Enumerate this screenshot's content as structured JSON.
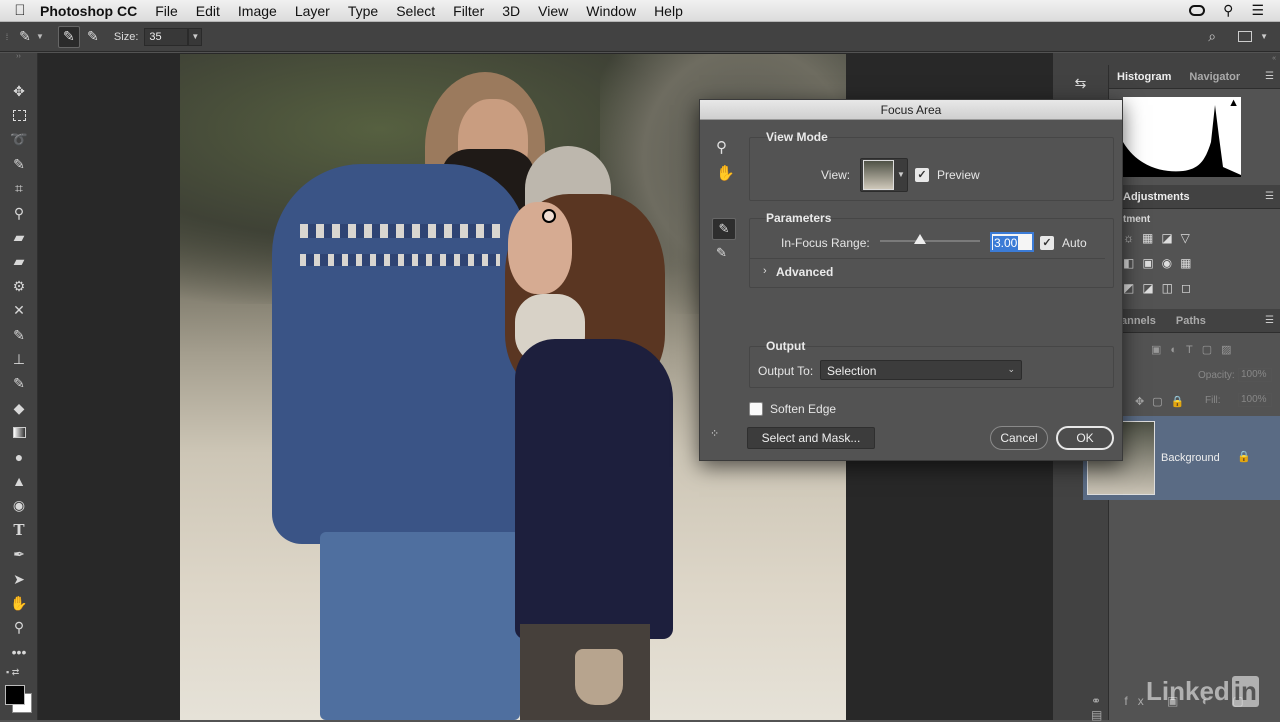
{
  "menubar": {
    "app_name": "Photoshop CC",
    "items": [
      "File",
      "Edit",
      "Image",
      "Layer",
      "Type",
      "Select",
      "Filter",
      "3D",
      "View",
      "Window",
      "Help"
    ]
  },
  "options_bar": {
    "size_label": "Size:",
    "size_value": "35"
  },
  "panels": {
    "histogram_tab": "Histogram",
    "navigator_tab": "Navigator",
    "adjustments_tab": "Adjustments",
    "adjustments_sub": "tment",
    "channels_tab": "annels",
    "paths_tab": "Paths",
    "opacity_label": "Opacity:",
    "opacity_value": "100%",
    "fill_label": "Fill:",
    "fill_value": "100%",
    "layer_name": "Background"
  },
  "dialog": {
    "title": "Focus Area",
    "view_mode_title": "View Mode",
    "view_label": "View:",
    "preview_label": "Preview",
    "preview_checked": true,
    "parameters_title": "Parameters",
    "in_focus_label": "In-Focus Range:",
    "in_focus_value": "3.00",
    "in_focus_slider": 0.4,
    "auto_label": "Auto",
    "auto_checked": true,
    "advanced_label": "Advanced",
    "output_title": "Output",
    "output_to_label": "Output To:",
    "output_to_value": "Selection",
    "soften_edge_label": "Soften Edge",
    "soften_edge_checked": false,
    "select_mask_label": "Select and Mask...",
    "cancel_label": "Cancel",
    "ok_label": "OK"
  },
  "watermark": "Linked",
  "watermark_in": "in"
}
